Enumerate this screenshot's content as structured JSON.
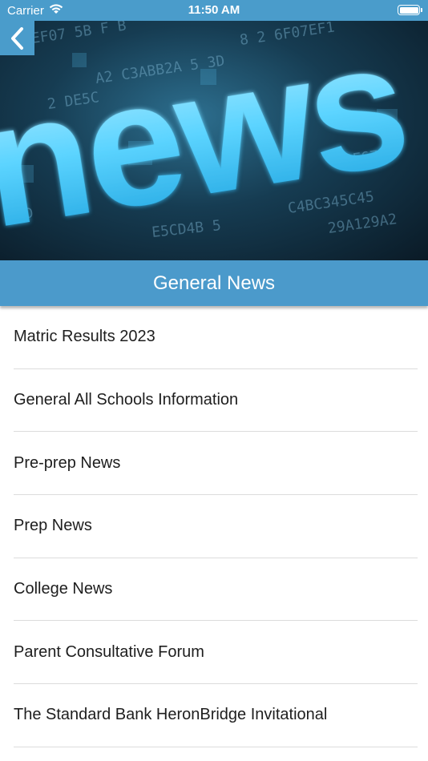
{
  "status_bar": {
    "carrier": "Carrier",
    "time": "11:50 AM",
    "wifi_icon": "wifi-icon",
    "battery_icon": "battery-full-icon"
  },
  "header": {
    "back_icon": "chevron-left-icon",
    "hero_word": "news",
    "title": "General News",
    "accent_color": "#4b9acb"
  },
  "news_items": [
    {
      "label": "Matric Results 2023"
    },
    {
      "label": "General All Schools Information"
    },
    {
      "label": "Pre-prep News"
    },
    {
      "label": "Prep News"
    },
    {
      "label": "College News"
    },
    {
      "label": "Parent Consultative Forum"
    },
    {
      "label": "The Standard Bank HeronBridge Invitational"
    }
  ]
}
